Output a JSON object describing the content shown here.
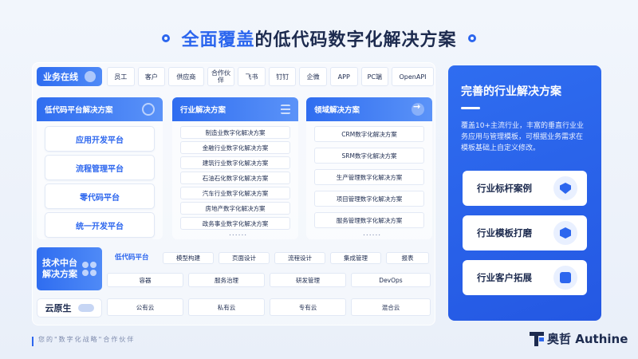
{
  "header": {
    "title_highlight": "全面覆盖",
    "title_rest": "的低代码数字化解决方案"
  },
  "business_row": {
    "label": "业务在线",
    "chips": [
      "员工",
      "客户",
      "供应商",
      "合作伙伴",
      "飞书",
      "钉钉",
      "企微",
      "APP",
      "PC端",
      "OpenAPI"
    ]
  },
  "lowcode_panel": {
    "title": "低代码平台解决方案",
    "items": [
      "应用开发平台",
      "流程管理平台",
      "零代码平台",
      "统一开发平台"
    ]
  },
  "industry_panel": {
    "title": "行业解决方案",
    "items": [
      "制造业数字化解决方案",
      "金融行业数字化解决方案",
      "建筑行业数字化解决方案",
      "石油石化数字化解决方案",
      "汽车行业数字化解决方案",
      "房地产数字化解决方案",
      "政务事业数字化解决方案"
    ],
    "more": "......"
  },
  "domain_panel": {
    "title": "领域解决方案",
    "items": [
      "CRM数字化解决方案",
      "SRM数字化解决方案",
      "生产管理数字化解决方案",
      "项目管理数字化解决方案",
      "服务管理数字化解决方案"
    ],
    "more": "......"
  },
  "tech_row": {
    "label_line1": "技术中台",
    "label_line2": "解决方案",
    "lowcode_label": "低代码平台",
    "lowcode_chips": [
      "模型构建",
      "页面设计",
      "流程设计",
      "集成管理",
      "报表"
    ],
    "bottom_chips": [
      "容器",
      "服务治理",
      "研发管理",
      "DevOps"
    ]
  },
  "cloud_row": {
    "label": "云原生",
    "chips": [
      "公有云",
      "私有云",
      "专有云",
      "混合云"
    ]
  },
  "right_panel": {
    "title": "完善的行业解决方案",
    "description": "覆盖10+主流行业，丰富的垂直行业业务应用与管理模板，可根据业务需求在模板基础上自定义修改。",
    "cards": [
      "行业标杆案例",
      "行业模板打磨",
      "行业客户拓展"
    ]
  },
  "footer": {
    "slogan": "您的\"数字化战略\"合作伙伴",
    "brand_cn": "奥哲",
    "brand_en": "Authine"
  },
  "colors": {
    "accent": "#2c66ee",
    "dark_text": "#1d2b4f",
    "background": "#f2f6fc"
  }
}
